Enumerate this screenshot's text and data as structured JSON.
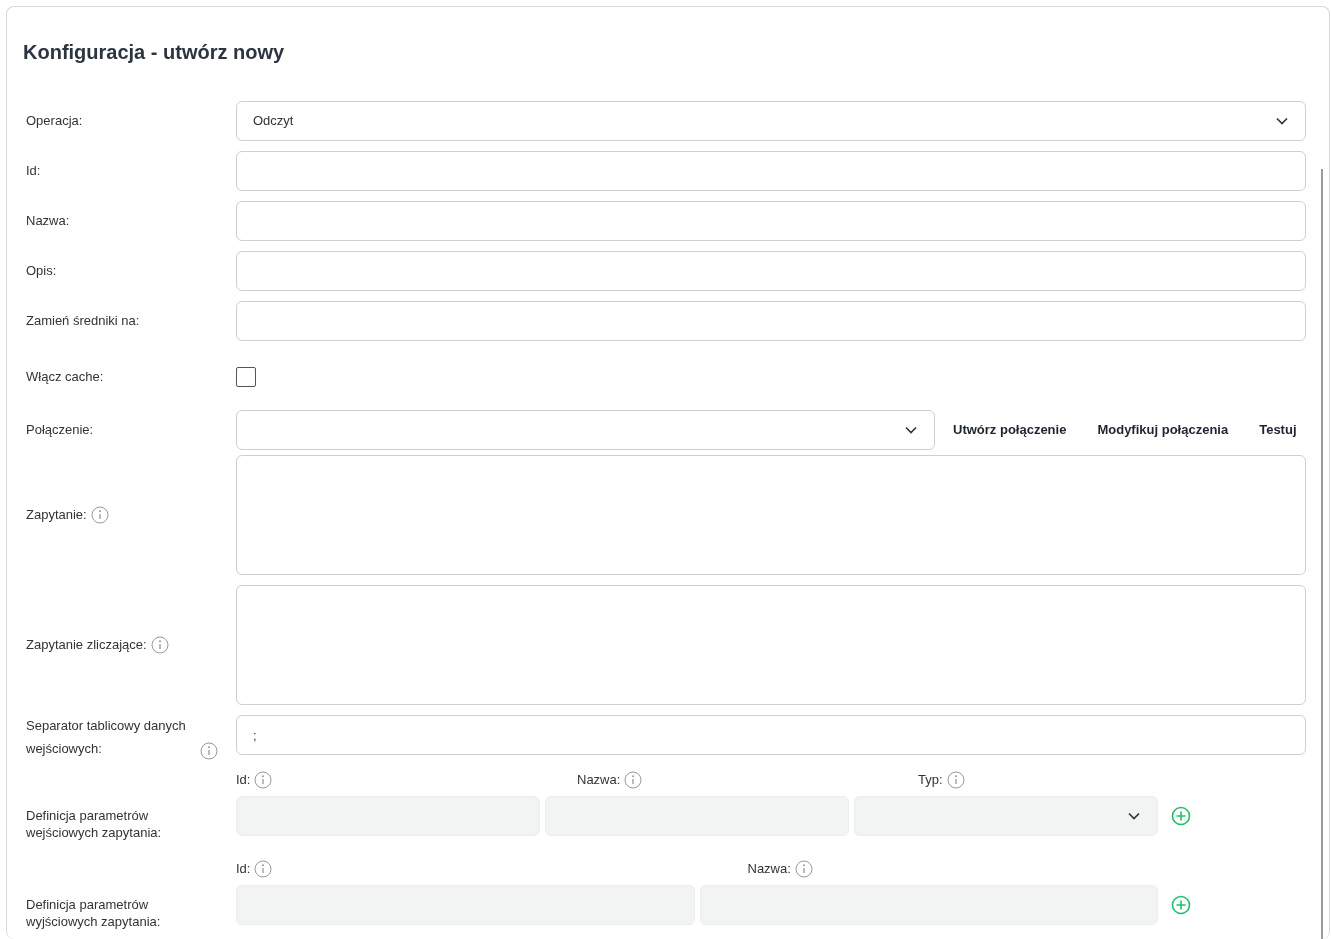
{
  "title": "Konfiguracja - utwórz nowy",
  "fields": [
    {
      "kind": "select",
      "label": "Operacja:",
      "value": "Odczyt"
    },
    {
      "kind": "text",
      "label": "Id:"
    },
    {
      "kind": "text",
      "label": "Nazwa:"
    },
    {
      "kind": "text",
      "label": "Opis:"
    },
    {
      "kind": "text",
      "label": "Zamień średniki na:"
    },
    {
      "kind": "checkbox",
      "label": "Włącz cache:",
      "checked": false
    },
    {
      "kind": "connection",
      "label": "Połączenie:",
      "buttons": [
        "Utwórz połączenie",
        "Modyfikuj połączenia",
        "Testuj"
      ]
    },
    {
      "kind": "textarea",
      "label": "Zapytanie:",
      "info": true
    },
    {
      "kind": "textarea",
      "label": "Zapytanie zliczające:",
      "info": true
    },
    {
      "kind": "text",
      "label": "Separator tablicowy danych wejściowych:",
      "info": true,
      "value": ";"
    },
    {
      "kind": "params",
      "label": "Definicja parametrów wejściowych zapytania:",
      "columns": [
        {
          "kind": "text",
          "label": "Id:"
        },
        {
          "kind": "text",
          "label": "Nazwa:"
        },
        {
          "kind": "select",
          "label": "Typ:"
        }
      ]
    },
    {
      "kind": "params",
      "label": "Definicja parametrów wyjściowych zapytania:",
      "columns": [
        {
          "kind": "text",
          "label": "Id:"
        },
        {
          "kind": "text",
          "label": "Nazwa:"
        }
      ]
    }
  ]
}
